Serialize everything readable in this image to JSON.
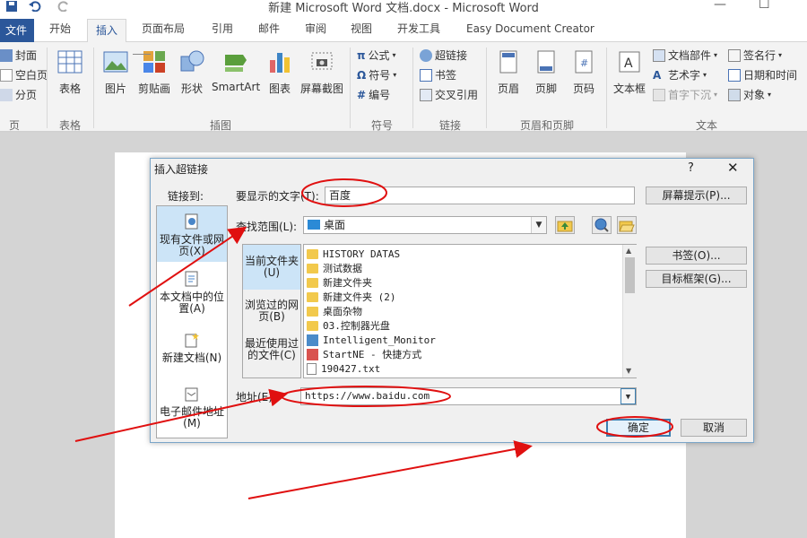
{
  "window": {
    "title": "新建 Microsoft Word 文档.docx - Microsoft Word",
    "minimize": "—",
    "maximize": "☐"
  },
  "tabs": [
    "文件",
    "开始",
    "插入",
    "页面布局",
    "引用",
    "邮件",
    "审阅",
    "视图",
    "开发工具",
    "Easy Document Creator"
  ],
  "ribbon": {
    "pages_group": {
      "items": [
        "封面",
        "空白页",
        "分页"
      ],
      "label": "页"
    },
    "table_group": {
      "item": "表格",
      "label": "表格"
    },
    "illustrations": {
      "items": [
        "图片",
        "剪贴画",
        "形状",
        "SmartArt",
        "图表",
        "屏幕截图"
      ],
      "label": "插图"
    },
    "symbols": {
      "items": [
        "公式",
        "符号",
        "编号"
      ],
      "label": "符号"
    },
    "links": {
      "items": [
        "超链接",
        "书签",
        "交叉引用"
      ],
      "label": "链接"
    },
    "header_footer": {
      "items": [
        "页眉",
        "页脚",
        "页码"
      ],
      "label": "页眉和页脚"
    },
    "text": {
      "textbox": "文本框",
      "items_col1": [
        "文档部件",
        "艺术字",
        "首字下沉"
      ],
      "items_col2": [
        "签名行",
        "日期和时间",
        "对象"
      ],
      "label": "文本"
    }
  },
  "dialog": {
    "title": "插入超链接",
    "help": "?",
    "close": "✕",
    "link_to_label": "链接到:",
    "link_to_items": [
      "现有文件或网页(X)",
      "本文档中的位置(A)",
      "新建文档(N)",
      "电子邮件地址(M)"
    ],
    "display_text_label": "要显示的文字(T):",
    "display_text_value": "百度",
    "screen_tip_button": "屏幕提示(P)...",
    "look_in_label": "查找范围(L):",
    "look_in_value": "桌面",
    "side_tabs": [
      "当前文件夹(U)",
      "浏览过的网页(B)",
      "最近使用过的文件(C)"
    ],
    "files": [
      "HISTORY DATAS",
      "测试数据",
      "新建文件夹",
      "新建文件夹 (2)",
      "桌面杂物",
      "03.控制器光盘",
      "Intelligent_Monitor",
      "StartNE - 快捷方式",
      "190427.txt"
    ],
    "bookmark_button": "书签(O)...",
    "target_frame_button": "目标框架(G)...",
    "address_label": "地址(E):",
    "address_value": "https://www.baidu.com",
    "ok_button": "确定",
    "cancel_button": "取消"
  },
  "colors": {
    "file_tab": "#2b579a",
    "annotation": "#e01010",
    "dialog_border": "#7aa5c8"
  }
}
